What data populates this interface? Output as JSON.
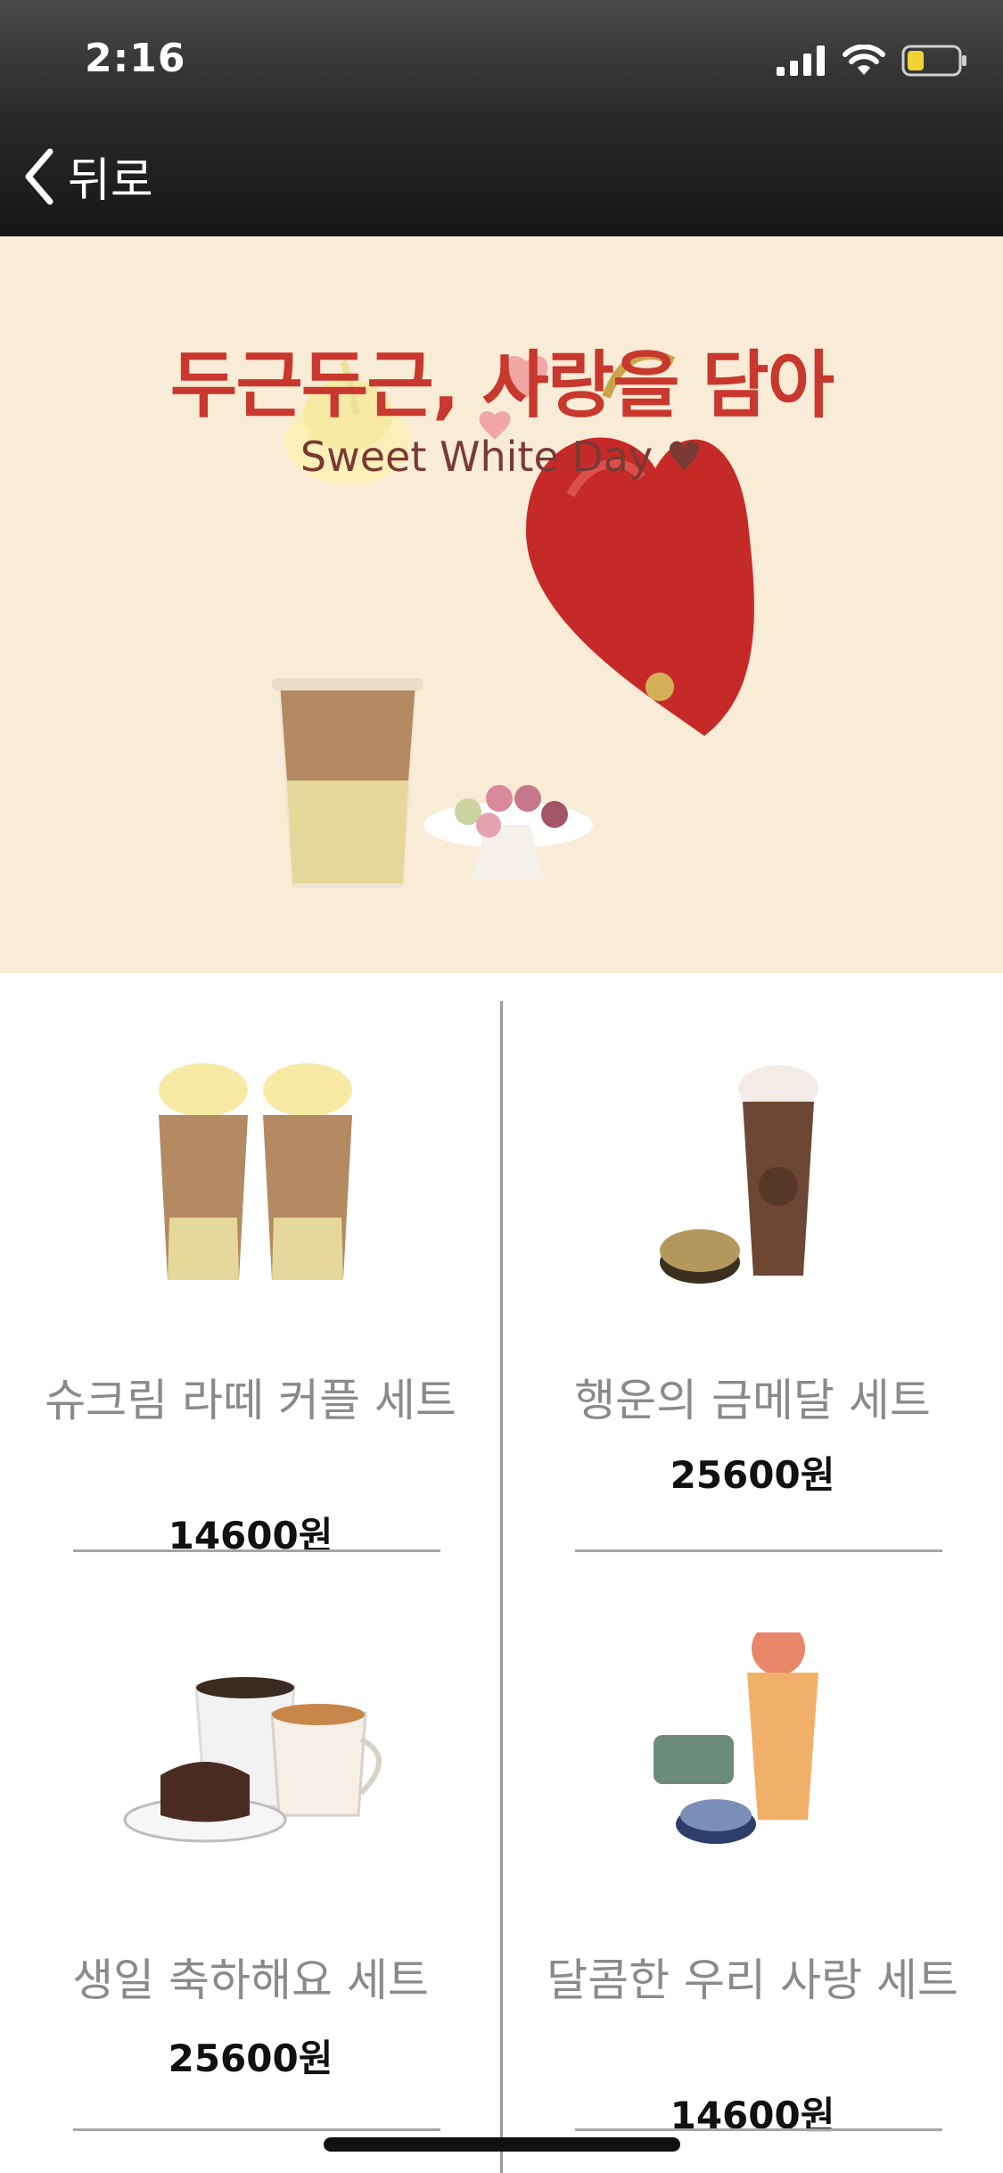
{
  "status": {
    "time": "2:16"
  },
  "nav": {
    "back_label": "뒤로"
  },
  "banner": {
    "title": "두근두근, 사랑을 담아",
    "subtitle": "Sweet White Day ♥"
  },
  "products": [
    {
      "name": "슈크림 라떼 커플 세트",
      "price": "14600원"
    },
    {
      "name": "행운의 금메달 세트",
      "price": "25600원"
    },
    {
      "name": "생일 축하해요 세트",
      "price": "25600원"
    },
    {
      "name": "달콤한 우리 사랑 세트",
      "price": "14600원"
    }
  ],
  "colors": {
    "banner_bg": "#f8ecd6",
    "title_red": "#c8382e",
    "header_dark": "#1a1a1a"
  }
}
